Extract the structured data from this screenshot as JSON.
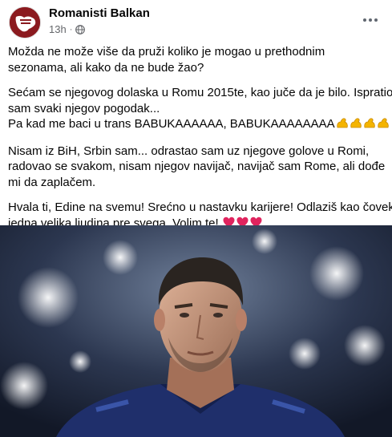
{
  "post": {
    "page_name": "Romanisti Balkan",
    "time": "13h",
    "separator": "·",
    "privacy_icon": "globe-icon",
    "more_icon": "more-options-icon",
    "paragraphs": [
      {
        "lines": [
          "Možda ne može više da pruži koliko je mogao u prethodnim",
          "sezonama, ali kako da ne bude žao?"
        ]
      },
      {
        "lines": [
          "Sećam se njegovog dolaska u Romu 2015te, kao juče da je bilo. Ispratio",
          "sam svaki njegov pogodak..."
        ]
      },
      {
        "lines": [
          "Pa kad me baci u trans BABUKAAAAAA, BABUKAAAAAAAA"
        ],
        "emoji": "flexed-biceps-icon"
      },
      {
        "lines": [
          "Nisam iz BiH, Srbin sam... odrastao sam uz njegove golove u Romi,",
          "radovao se svakom, nisam njegov navijač, navijač sam Rome, ali dođe",
          "mi da zaplačem."
        ]
      },
      {
        "lines": [
          "Hvala ti, Edine na svemu! Srećno u nastavku karijere! Odlaziš kao čovek,",
          "jedna velika ljudina pre svega. Volim te!"
        ],
        "emoji": "red-heart-icon"
      }
    ]
  },
  "colors": {
    "text": "#050505",
    "meta": "#65676b",
    "avatar_bg": "#8b1a1f",
    "heart": "#e0245e",
    "biceps": "#f4b400",
    "stadium_bg": "#1c2433",
    "jersey": "#1f2f6b"
  }
}
